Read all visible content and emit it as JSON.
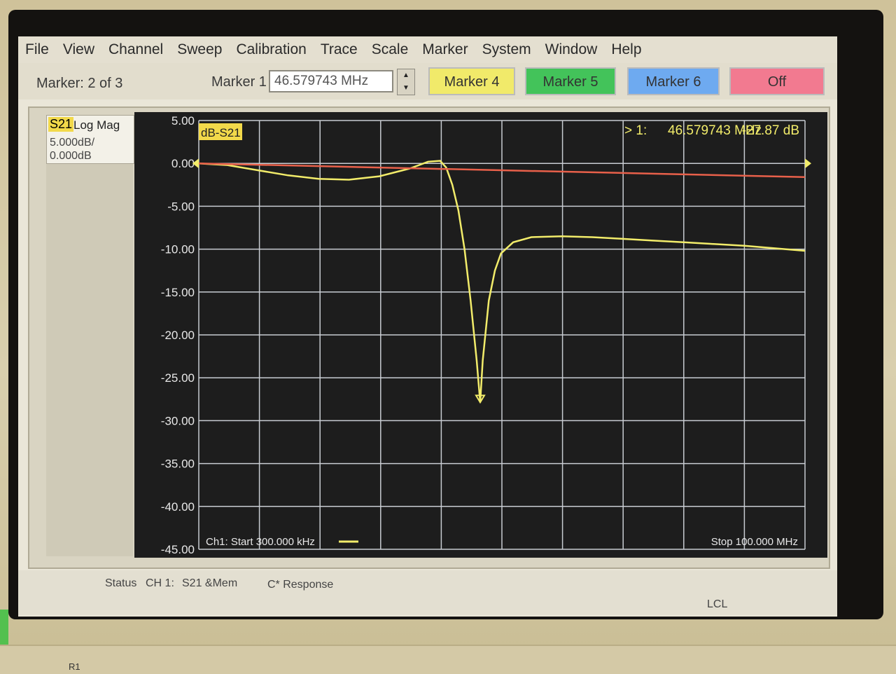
{
  "menu": {
    "items": [
      {
        "label": "File",
        "name": "menu-file"
      },
      {
        "label": "View",
        "name": "menu-view"
      },
      {
        "label": "Channel",
        "name": "menu-channel"
      },
      {
        "label": "Sweep",
        "name": "menu-sweep"
      },
      {
        "label": "Calibration",
        "name": "menu-calibration"
      },
      {
        "label": "Trace",
        "name": "menu-trace"
      },
      {
        "label": "Scale",
        "name": "menu-scale"
      },
      {
        "label": "Marker",
        "name": "menu-marker"
      },
      {
        "label": "System",
        "name": "menu-system"
      },
      {
        "label": "Window",
        "name": "menu-window"
      },
      {
        "label": "Help",
        "name": "menu-help"
      }
    ]
  },
  "toolbar": {
    "marker_status": "Marker: 2 of 3",
    "marker1_label": "Marker 1",
    "marker1_value": "46.579743 MHz",
    "marker4": "Marker 4",
    "marker5": "Marker 5",
    "marker6": "Marker 6",
    "off": "Off"
  },
  "trace_info": {
    "param": "S21",
    "format": "Log Mag",
    "scale": "5.000dB/",
    "ref": "0.000dB"
  },
  "status": {
    "status": "Status",
    "ch": "CH 1:",
    "meas": "S21 &Mem",
    "response": "C* Response",
    "lcl": "LCL"
  },
  "chart_data": {
    "type": "line",
    "trace_label": "dB-S21",
    "marker_readout": {
      "id": "> 1:",
      "freq": "46.579743 MHz",
      "value": "-27.87 dB"
    },
    "start_label": "Ch1: Start  300.000 kHz",
    "stop_label": "Stop  100.000 MHz",
    "xlim": [
      0.3,
      100
    ],
    "ylim": [
      -45,
      5
    ],
    "y_ticks": [
      "5.00",
      "0.00",
      "-5.00",
      "-10.00",
      "-15.00",
      "-20.00",
      "-25.00",
      "-30.00",
      "-35.00",
      "-40.00",
      "-45.00"
    ],
    "grid": true,
    "colors": {
      "data": "#f2ec6a",
      "memory": "#e8604a",
      "grid": "#c8ccd2",
      "tick_text": "#e8e8e8"
    },
    "series": [
      {
        "role": "data",
        "x": [
          0.3,
          5,
          10,
          15,
          20,
          25,
          30,
          35,
          38,
          40,
          41,
          42,
          43,
          44,
          45,
          46,
          46.58,
          47,
          48,
          49,
          50,
          52,
          55,
          60,
          65,
          70,
          75,
          80,
          85,
          90,
          95,
          100
        ],
        "y": [
          0.0,
          -0.2,
          -0.8,
          -1.4,
          -1.8,
          -1.9,
          -1.5,
          -0.6,
          0.2,
          0.3,
          -0.5,
          -2.5,
          -5.5,
          -10.0,
          -16.0,
          -23.0,
          -27.87,
          -23.0,
          -16.0,
          -12.5,
          -10.5,
          -9.2,
          -8.6,
          -8.5,
          -8.6,
          -8.8,
          -9.0,
          -9.2,
          -9.4,
          -9.6,
          -9.9,
          -10.2
        ]
      },
      {
        "role": "memory",
        "x": [
          0.3,
          25,
          50,
          75,
          100
        ],
        "y": [
          0.0,
          -0.4,
          -0.8,
          -1.2,
          -1.6
        ]
      }
    ],
    "marker": {
      "x": 46.58,
      "y": -27.87
    }
  }
}
